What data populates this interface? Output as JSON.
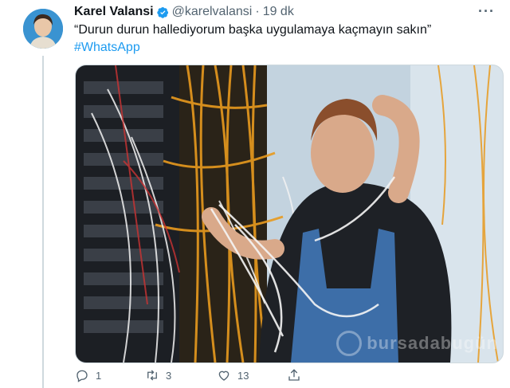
{
  "tweet": {
    "author_name": "Karel Valansi",
    "handle": "@karelvalansi",
    "separator": "·",
    "time": "19 dk",
    "text": "“Durun durun hallediyorum başka uygulamaya kaçmayın sakın”",
    "hashtag": "#WhatsApp",
    "menu": "···"
  },
  "media": {
    "watermark": "bursadabugün",
    "description_icon": "photo"
  },
  "actions": {
    "reply_count": "1",
    "retweet_count": "3",
    "like_count": "13"
  },
  "colors": {
    "link": "#1d9bf0",
    "secondary_text": "#536471",
    "verified": "#1d9bf0"
  }
}
